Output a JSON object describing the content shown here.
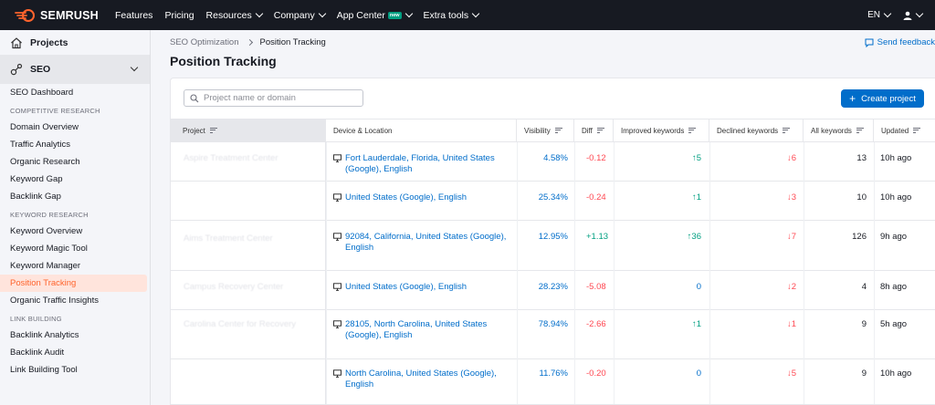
{
  "topbar": {
    "brand": "SEMRUSH",
    "nav": [
      {
        "label": "Features",
        "dropdown": false
      },
      {
        "label": "Pricing",
        "dropdown": false
      },
      {
        "label": "Resources",
        "dropdown": true
      },
      {
        "label": "Company",
        "dropdown": true
      },
      {
        "label": "App Center",
        "dropdown": true,
        "badge": "new"
      },
      {
        "label": "Extra tools",
        "dropdown": true
      }
    ],
    "language": "EN"
  },
  "sidebar": {
    "projects_label": "Projects",
    "seo_label": "SEO",
    "items": [
      {
        "type": "item",
        "label": "SEO Dashboard"
      },
      {
        "type": "section",
        "label": "COMPETITIVE RESEARCH"
      },
      {
        "type": "item",
        "label": "Domain Overview"
      },
      {
        "type": "item",
        "label": "Traffic Analytics"
      },
      {
        "type": "item",
        "label": "Organic Research"
      },
      {
        "type": "item",
        "label": "Keyword Gap"
      },
      {
        "type": "item",
        "label": "Backlink Gap"
      },
      {
        "type": "section",
        "label": "KEYWORD RESEARCH"
      },
      {
        "type": "item",
        "label": "Keyword Overview"
      },
      {
        "type": "item",
        "label": "Keyword Magic Tool"
      },
      {
        "type": "item",
        "label": "Keyword Manager"
      },
      {
        "type": "item",
        "label": "Position Tracking",
        "active": true
      },
      {
        "type": "item",
        "label": "Organic Traffic Insights"
      },
      {
        "type": "section",
        "label": "LINK BUILDING"
      },
      {
        "type": "item",
        "label": "Backlink Analytics"
      },
      {
        "type": "item",
        "label": "Backlink Audit"
      },
      {
        "type": "item",
        "label": "Link Building Tool"
      }
    ]
  },
  "main": {
    "breadcrumb": {
      "parent": "SEO Optimization",
      "current": "Position Tracking"
    },
    "title": "Position Tracking",
    "feedback_label": "Send feedback",
    "search_placeholder": "Project name or domain",
    "create_button": "Create project",
    "columns": {
      "project": "Project",
      "device": "Device & Location",
      "visibility": "Visibility",
      "diff": "Diff",
      "improved": "Improved keywords",
      "declined": "Declined keywords",
      "all": "All keywords",
      "updated": "Updated"
    },
    "rows": [
      {
        "project": "Aspire Treatment Center",
        "location": "Fort Lauderdale, Florida, United States (Google), English",
        "visibility": "4.58%",
        "diff": "-0.12",
        "improved": "↑5",
        "declined": "↓6",
        "all": "13",
        "updated": "10h ago"
      },
      {
        "project": "",
        "location": "United States (Google), English",
        "visibility": "25.34%",
        "diff": "-0.24",
        "improved": "↑1",
        "declined": "↓3",
        "all": "10",
        "updated": "10h ago"
      },
      {
        "project": "Aims Treatment Center",
        "location": "92084, California, United States (Google), English",
        "visibility": "12.95%",
        "diff": "+1.13",
        "improved": "↑36",
        "declined": "↓7",
        "all": "126",
        "updated": "9h ago"
      },
      {
        "project": "Campus Recovery Center",
        "location": "United States (Google), English",
        "visibility": "28.23%",
        "diff": "-5.08",
        "improved": "0",
        "declined": "↓2",
        "all": "4",
        "updated": "8h ago"
      },
      {
        "project": "Carolina Center for Recovery",
        "location": "28105, North Carolina, United States (Google), English",
        "visibility": "78.94%",
        "diff": "-2.66",
        "improved": "↑1",
        "declined": "↓1",
        "all": "9",
        "updated": "5h ago"
      },
      {
        "project": "",
        "location": "North Carolina, United States (Google), English",
        "visibility": "11.76%",
        "diff": "-0.20",
        "improved": "0",
        "declined": "↓5",
        "all": "9",
        "updated": "10h ago"
      }
    ]
  }
}
